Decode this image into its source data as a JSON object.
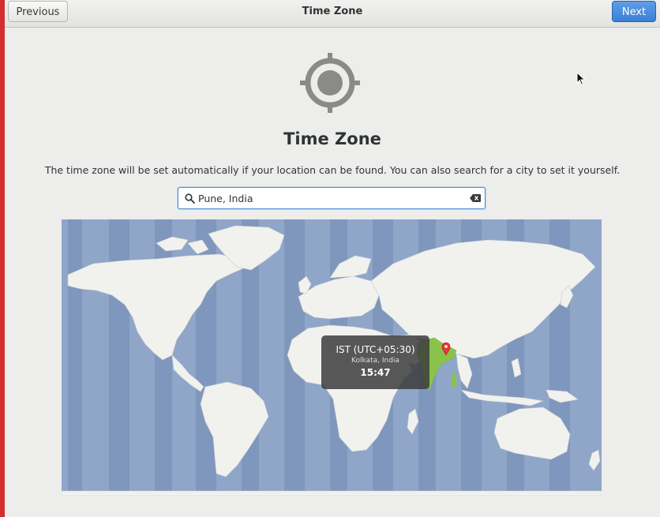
{
  "header": {
    "previous_label": "Previous",
    "title": "Time Zone",
    "next_label": "Next"
  },
  "page": {
    "icon": "location-target-icon",
    "title": "Time Zone",
    "description": "The time zone will be set automatically if your location can be found. You can also search for a city to set it yourself."
  },
  "search": {
    "value": "Pune, India",
    "icon": "search-icon",
    "clear_icon": "clear-text-icon"
  },
  "map": {
    "highlighted_zone_color": "#8bc34a",
    "marker_icon": "map-pin-icon",
    "tooltip": {
      "zone": "IST (UTC+05:30)",
      "city": "Kolkata, India",
      "time": "15:47"
    }
  },
  "colors": {
    "accent": "#3b7fd6",
    "ocean": "#8fa6c9",
    "land": "#f1f1ee",
    "window_edge": "#d32f2f"
  }
}
